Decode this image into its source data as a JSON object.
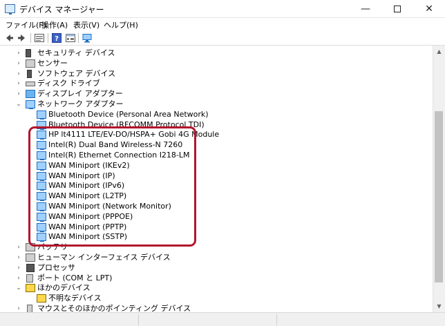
{
  "window": {
    "title": "デバイス マネージャー",
    "minimize_glyph": "—",
    "close_glyph": "✕"
  },
  "menu": [
    "ファイル(F)",
    "操作(A)",
    "表示(V)",
    "ヘルプ(H)"
  ],
  "tree": {
    "rows": [
      {
        "label": "セキュリティ デバイス",
        "expander": "›",
        "icon": "security-device-icon"
      },
      {
        "label": "センサー",
        "expander": "›",
        "icon": "sensor-icon"
      },
      {
        "label": "ソフトウェア デバイス",
        "expander": "›",
        "icon": "software-device-icon"
      },
      {
        "label": "ディスク ドライブ",
        "expander": "›",
        "icon": "disk-drive-icon"
      },
      {
        "label": "ディスプレイ アダプター",
        "expander": "›",
        "icon": "display-adapter-icon"
      },
      {
        "label": "ネットワーク アダプター",
        "expander": "⌄",
        "icon": "network-adapter-icon"
      },
      {
        "label": "Bluetooth Device (Personal Area Network)",
        "icon": "network-icon"
      },
      {
        "label": "Bluetooth Device (RFCOMM Protocol TDI)",
        "icon": "network-icon"
      },
      {
        "label": "HP lt4111 LTE/EV-DO/HSPA+ Gobi 4G Module",
        "icon": "network-icon"
      },
      {
        "label": "Intel(R) Dual Band Wireless-N 7260",
        "icon": "network-icon"
      },
      {
        "label": "Intel(R) Ethernet Connection I218-LM",
        "icon": "network-icon"
      },
      {
        "label": "WAN Miniport (IKEv2)",
        "icon": "network-icon"
      },
      {
        "label": "WAN Miniport (IP)",
        "icon": "network-icon"
      },
      {
        "label": "WAN Miniport (IPv6)",
        "icon": "network-icon"
      },
      {
        "label": "WAN Miniport (L2TP)",
        "icon": "network-icon"
      },
      {
        "label": "WAN Miniport (Network Monitor)",
        "icon": "network-icon"
      },
      {
        "label": "WAN Miniport (PPPOE)",
        "icon": "network-icon"
      },
      {
        "label": "WAN Miniport (PPTP)",
        "icon": "network-icon"
      },
      {
        "label": "WAN Miniport (SSTP)",
        "icon": "network-icon"
      },
      {
        "label": "バッテリ",
        "expander": "›",
        "icon": "battery-icon"
      },
      {
        "label": "ヒューマン インターフェイス デバイス",
        "expander": "›",
        "icon": "hid-icon"
      },
      {
        "label": "プロセッサ",
        "expander": "›",
        "icon": "processor-icon"
      },
      {
        "label": "ポート (COM と LPT)",
        "expander": "›",
        "icon": "port-icon"
      },
      {
        "label": "ほかのデバイス",
        "expander": "⌄",
        "icon": "other-device-icon"
      },
      {
        "label": "不明なデバイス",
        "icon": "unknown-device-warning-icon"
      },
      {
        "label": "マウスとそのほかのポインティング デバイス",
        "expander": "›",
        "icon": "mouse-icon"
      }
    ]
  },
  "annotation": {
    "color": "#b3132b"
  }
}
